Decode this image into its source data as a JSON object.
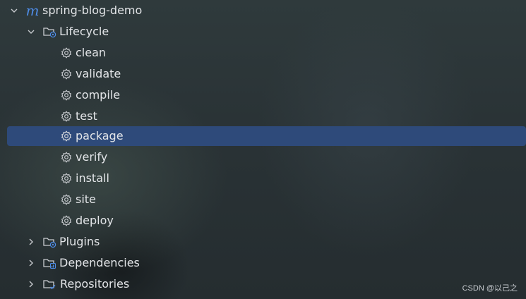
{
  "project": {
    "name": "spring-blog-demo",
    "icon": "maven-icon"
  },
  "lifecycle": {
    "label": "Lifecycle",
    "icon": "folder-gear-icon",
    "expanded": true,
    "goals": [
      {
        "label": "clean"
      },
      {
        "label": "validate"
      },
      {
        "label": "compile"
      },
      {
        "label": "test"
      },
      {
        "label": "package"
      },
      {
        "label": "verify"
      },
      {
        "label": "install"
      },
      {
        "label": "site"
      },
      {
        "label": "deploy"
      }
    ],
    "selected_goal": "package"
  },
  "nodes": [
    {
      "label": "Plugins",
      "icon": "folder-gear-icon",
      "expanded": false
    },
    {
      "label": "Dependencies",
      "icon": "folder-chart-icon",
      "expanded": false
    },
    {
      "label": "Repositories",
      "icon": "folder-check-icon",
      "expanded": false
    }
  ],
  "watermark": "CSDN @以己之",
  "colors": {
    "selection": "#2e4a7a",
    "accent": "#4e8ce6",
    "text": "#dfe1e5"
  }
}
